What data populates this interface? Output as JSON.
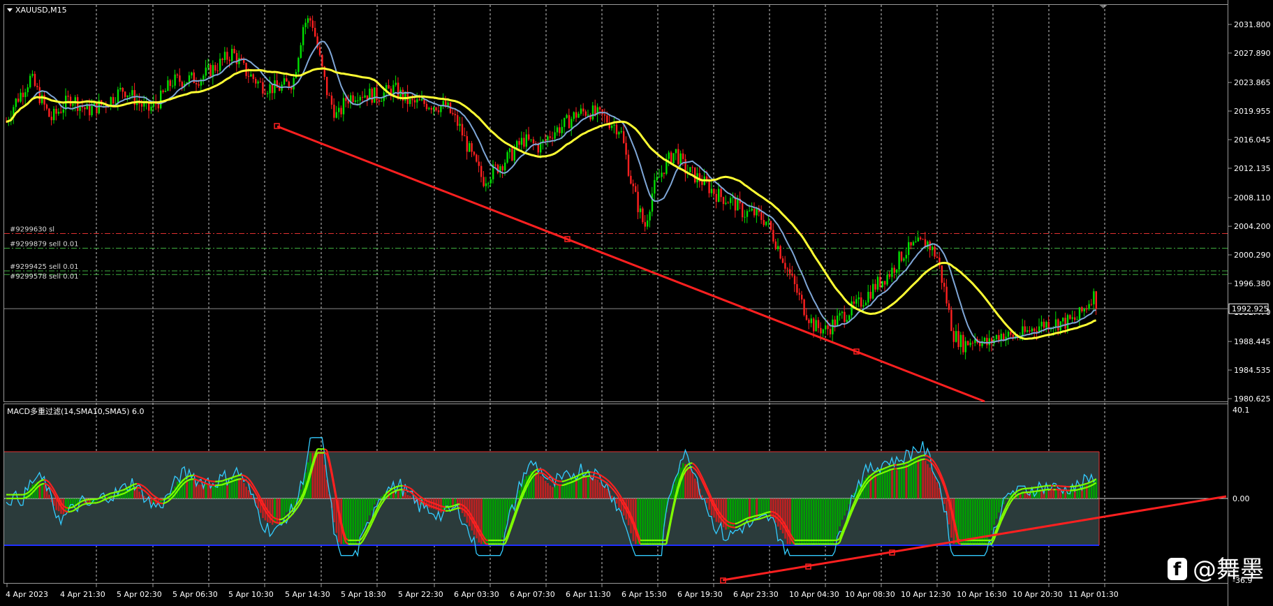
{
  "symbol_label": "XAUUSD,M15",
  "current_price": "1992.925",
  "orders": [
    {
      "label": "#9299630 sl",
      "price": 2003.2,
      "color": "#e03030"
    },
    {
      "label": "#9299879 sell 0.01",
      "price": 2001.2,
      "color": "#3fae3f"
    },
    {
      "label": "#9299425 sell 0.01",
      "price": 1998.1,
      "color": "#3fae3f"
    },
    {
      "label": "#9299578 sell 0.01",
      "price": 1997.6,
      "color": "#3fae3f"
    }
  ],
  "indicator_label": "MACD多重过滤(14,SMA10,SMA5) 6.0",
  "watermark": {
    "icon": "facebook-logo-icon",
    "text": "@舞墨"
  },
  "colors": {
    "background": "#000000",
    "bull": "#00e000",
    "bear": "#ff2020",
    "fast_ma": "#ffff33",
    "slow_ma": "#7fa7d8",
    "trendline": "#ff2020",
    "macd_band": "#2b3b3b",
    "macd_signal_bull": "#7fff00",
    "macd_signal_bear": "#ff2020",
    "macd_line": "#33ccff"
  },
  "chart_data": [
    {
      "type": "candlestick",
      "title": "XAUUSD,M15",
      "x_ticks": [
        "4 Apr 2023",
        "4 Apr 21:30",
        "5 Apr 02:30",
        "5 Apr 06:30",
        "5 Apr 10:30",
        "5 Apr 14:30",
        "5 Apr 18:30",
        "5 Apr 22:30",
        "6 Apr 03:30",
        "6 Apr 07:30",
        "6 Apr 11:30",
        "6 Apr 15:30",
        "6 Apr 19:30",
        "6 Apr 23:30",
        "10 Apr 04:30",
        "10 Apr 08:30",
        "10 Apr 12:30",
        "10 Apr 16:30",
        "10 Apr 20:30",
        "11 Apr 01:30"
      ],
      "y_ticks": [
        2031.8,
        2027.89,
        2023.865,
        2019.955,
        2016.045,
        2012.135,
        2008.11,
        2004.2,
        2000.29,
        1996.38,
        1992.47,
        1988.445,
        1984.535,
        1980.625
      ],
      "y_tick_labels": [
        "2031.800",
        "2027.890",
        "2023.865",
        "2019.955",
        "2016.045",
        "2012.135",
        "2008.110",
        "2004.200",
        "2000.290",
        "1996.380",
        "1992.470",
        "1988.445",
        "1984.535",
        "1980.625"
      ],
      "ylim": [
        1980.1,
        2034.0
      ],
      "price_path": [
        [
          0,
          2018.5
        ],
        [
          10,
          2021.0
        ],
        [
          30,
          2024.5
        ],
        [
          55,
          2018.8
        ],
        [
          80,
          2021.8
        ],
        [
          100,
          2020.0
        ],
        [
          125,
          2021.2
        ],
        [
          145,
          2023.0
        ],
        [
          160,
          2021.5
        ],
        [
          175,
          2020.0
        ],
        [
          190,
          2021.5
        ],
        [
          205,
          2024.0
        ],
        [
          240,
          2024.5
        ],
        [
          265,
          2026.5
        ],
        [
          280,
          2028.0
        ],
        [
          295,
          2025.5
        ],
        [
          315,
          2023.5
        ],
        [
          335,
          2023.0
        ],
        [
          355,
          2024.0
        ],
        [
          368,
          2032.0
        ],
        [
          378,
          2032.5
        ],
        [
          388,
          2027.0
        ],
        [
          398,
          2022.0
        ],
        [
          410,
          2019.0
        ],
        [
          420,
          2021.5
        ],
        [
          435,
          2022.5
        ],
        [
          460,
          2022.0
        ],
        [
          480,
          2023.0
        ],
        [
          500,
          2021.0
        ],
        [
          520,
          2021.0
        ],
        [
          545,
          2020.5
        ],
        [
          560,
          2018.0
        ],
        [
          575,
          2014.0
        ],
        [
          590,
          2010.5
        ],
        [
          605,
          2012.0
        ],
        [
          625,
          2014.0
        ],
        [
          640,
          2016.0
        ],
        [
          660,
          2015.0
        ],
        [
          675,
          2017.0
        ],
        [
          690,
          2018.0
        ],
        [
          705,
          2019.5
        ],
        [
          720,
          2020.0
        ],
        [
          740,
          2019.0
        ],
        [
          760,
          2017.5
        ],
        [
          775,
          2009.5
        ],
        [
          790,
          2004.0
        ],
        [
          800,
          2009.0
        ],
        [
          815,
          2012.5
        ],
        [
          828,
          2014.5
        ],
        [
          840,
          2012.0
        ],
        [
          860,
          2010.5
        ],
        [
          880,
          2008.5
        ],
        [
          900,
          2007.5
        ],
        [
          913,
          2006.0
        ],
        [
          925,
          2006.0
        ],
        [
          940,
          2005.0
        ],
        [
          955,
          2001.5
        ],
        [
          970,
          1997.5
        ],
        [
          985,
          1993.5
        ],
        [
          1000,
          1990.5
        ],
        [
          1015,
          1990.0
        ],
        [
          1035,
          1992.0
        ],
        [
          1055,
          1993.5
        ],
        [
          1075,
          1996.0
        ],
        [
          1095,
          1998.0
        ],
        [
          1110,
          2000.5
        ],
        [
          1125,
          2001.5
        ],
        [
          1140,
          2002.0
        ],
        [
          1152,
          2000.0
        ],
        [
          1162,
          1995.0
        ],
        [
          1172,
          1989.5
        ],
        [
          1185,
          1988.0
        ],
        [
          1200,
          1989.0
        ],
        [
          1215,
          1988.0
        ],
        [
          1230,
          1989.5
        ],
        [
          1245,
          1989.0
        ],
        [
          1260,
          1989.5
        ],
        [
          1275,
          1990.5
        ],
        [
          1290,
          1991.0
        ],
        [
          1310,
          1991.0
        ],
        [
          1325,
          1991.5
        ],
        [
          1338,
          1993.5
        ],
        [
          1345,
          1995.0
        ],
        [
          1352,
          1993.0
        ]
      ]
    },
    {
      "type": "histogram",
      "title": "MACD多重过滤(14,SMA10,SMA5) 6.0",
      "y_tick_labels": [
        "40.1",
        "0.00",
        "-36.9"
      ],
      "ylim": [
        -36.9,
        40.1
      ],
      "band": [
        -36.9,
        36.9
      ]
    }
  ]
}
